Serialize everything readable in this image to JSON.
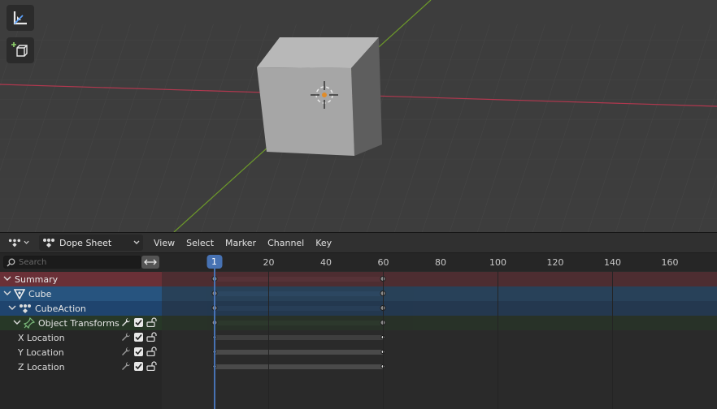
{
  "viewport": {
    "tools": [
      {
        "name": "measure",
        "icon": "measure-icon"
      },
      {
        "name": "add-cube",
        "icon": "add-cube-icon"
      }
    ],
    "colors": {
      "background": "#3d3d3d",
      "x_axis": "#b2384f",
      "y_axis": "#6d9a2a",
      "cube": "#a8a8a8"
    }
  },
  "dope_sheet": {
    "editor_icon": "dope-sheet-editor-icon",
    "mode": {
      "label": "Dope Sheet",
      "icon": "dope-sheet-mode-icon"
    },
    "menus": [
      "View",
      "Select",
      "Marker",
      "Channel",
      "Key"
    ],
    "search": {
      "placeholder": "Search",
      "value": ""
    },
    "channels": {
      "summary": "Summary",
      "object": "Cube",
      "action": "CubeAction",
      "group": "Object Transforms",
      "fcurves": [
        "X Location",
        "Y Location",
        "Z Location"
      ]
    },
    "ruler_ticks": [
      20,
      40,
      60,
      80,
      100,
      120,
      140,
      160
    ],
    "current_frame": "1",
    "keyframes": [
      1,
      60
    ],
    "colors": {
      "accent": "#4772b3",
      "summary": "#6a3037",
      "object": "#27547f",
      "action": "#1f446e",
      "group": "#273827"
    }
  }
}
